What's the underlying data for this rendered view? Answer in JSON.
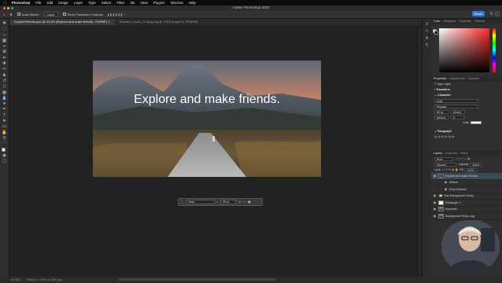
{
  "menubar": {
    "app": "Photoshop",
    "items": [
      "File",
      "Edit",
      "Image",
      "Layer",
      "Type",
      "Select",
      "Filter",
      "3D",
      "View",
      "Plugins",
      "Window",
      "Help"
    ]
  },
  "window": {
    "title": "Adobe Photoshop 2023"
  },
  "options": {
    "auto_select_label": "Auto-Select:",
    "auto_select_value": "Layer",
    "transform_label": "Show Transform Controls",
    "share_label": "Share"
  },
  "tabs": [
    "ExploreFriends.psd @ 33.3% (Explore and make friends., RGB/8*) ×",
    "Random_Room_1 copy.png @ 100% (Layer 1, RGB/8#)"
  ],
  "artwork": {
    "headline": "Explore and make friends."
  },
  "context_bar": {
    "font": "Arial",
    "size": "69 pt"
  },
  "status": {
    "zoom": "33.33%",
    "dims": "3600 px x 2000 px (300 ppi)"
  },
  "color_panel": {
    "tabs": [
      "Color",
      "Swatches",
      "Gradients",
      "Patterns"
    ]
  },
  "properties_panel": {
    "tabs": [
      "Properties",
      "Adjustments",
      "Libraries"
    ],
    "layer_type": "Type Layer",
    "transform_label": "Transform",
    "character_label": "Character",
    "font_family": "Arial",
    "font_style": "Regular",
    "font_size": "69 pt",
    "leading": "(Auto)",
    "kerning": "Metrics",
    "tracking": "0",
    "color_label": "Color",
    "paragraph_label": "Paragraph"
  },
  "layers_panel": {
    "tabs": [
      "Layers",
      "Channels",
      "Paths"
    ],
    "kind_label": "Kind",
    "blend_mode": "Normal",
    "opacity_label": "Opacity:",
    "opacity": "100%",
    "lock_label": "Lock:",
    "fill_label": "Fill:",
    "fill": "100%",
    "layers": [
      {
        "name": "Explore and make friends.",
        "kind": "text",
        "selected": true
      },
      {
        "name": "Effects",
        "kind": "effects",
        "selected": false
      },
      {
        "name": "Drop Shadow",
        "kind": "effect",
        "selected": false
      },
      {
        "name": "Nav Background Group",
        "kind": "group",
        "selected": false
      },
      {
        "name": "Rectangle 1",
        "kind": "white",
        "selected": false
      },
      {
        "name": "Mountain",
        "kind": "image",
        "selected": false
      },
      {
        "name": "Background Pinky copy",
        "kind": "image",
        "selected": false
      }
    ]
  },
  "colors": {
    "accent": "#2f7ad8",
    "selected_layer": "#3d4a5c"
  }
}
